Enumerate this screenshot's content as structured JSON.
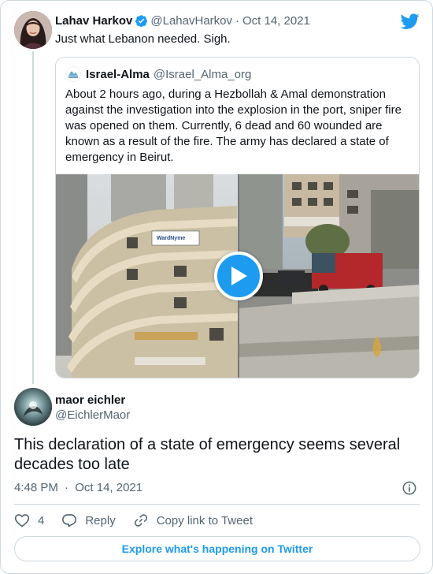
{
  "parent_tweet": {
    "name": "Lahav Harkov",
    "handle": "@LahavHarkov",
    "separator": "·",
    "date": "Oct 14, 2021",
    "text": "Just what Lebanon needed. Sigh.",
    "verified": true
  },
  "quoted_tweet": {
    "name": "Israel-Alma",
    "handle": "@Israel_Alma_org",
    "text": "About 2 hours ago, during a Hezbollah & Amal demonstration against the investigation into the explosion in the port, sniper fire was opened on them. Currently, 6 dead and 60 wounded are known as a result of the fire. The army has declared a state of emergency in Beirut.",
    "media": "video",
    "sign_text": "WardNyme"
  },
  "reply_tweet": {
    "name": "maor eichler",
    "handle": "@EichlerMaor",
    "text": "This declaration of a state of emergency seems several decades too late",
    "time": "4:48 PM",
    "separator": "·",
    "date": "Oct 14, 2021"
  },
  "actions": {
    "like_count": "4",
    "reply_label": "Reply",
    "copy_label": "Copy link to Tweet"
  },
  "explore_label": "Explore what's happening on Twitter",
  "colors": {
    "accent": "#1d9bf0",
    "text_secondary": "#536471",
    "border": "#cfd9de"
  }
}
